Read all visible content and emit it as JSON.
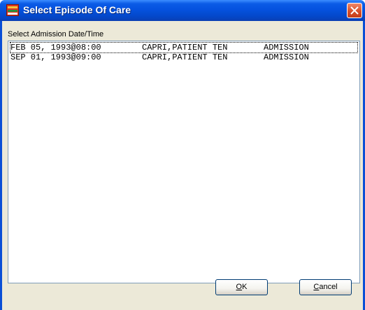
{
  "window": {
    "title": "Select Episode Of Care"
  },
  "list": {
    "label": "Select Admission Date/Time",
    "items": [
      {
        "date": "FEB 05, 1993@08:00",
        "patient": "CAPRI,PATIENT TEN",
        "type": "ADMISSION"
      },
      {
        "date": "SEP 01, 1993@09:00",
        "patient": "CAPRI,PATIENT TEN",
        "type": "ADMISSION"
      }
    ]
  },
  "buttons": {
    "ok": {
      "mnemonic": "O",
      "rest": "K"
    },
    "cancel": {
      "mnemonic": "C",
      "rest": "ancel"
    }
  }
}
